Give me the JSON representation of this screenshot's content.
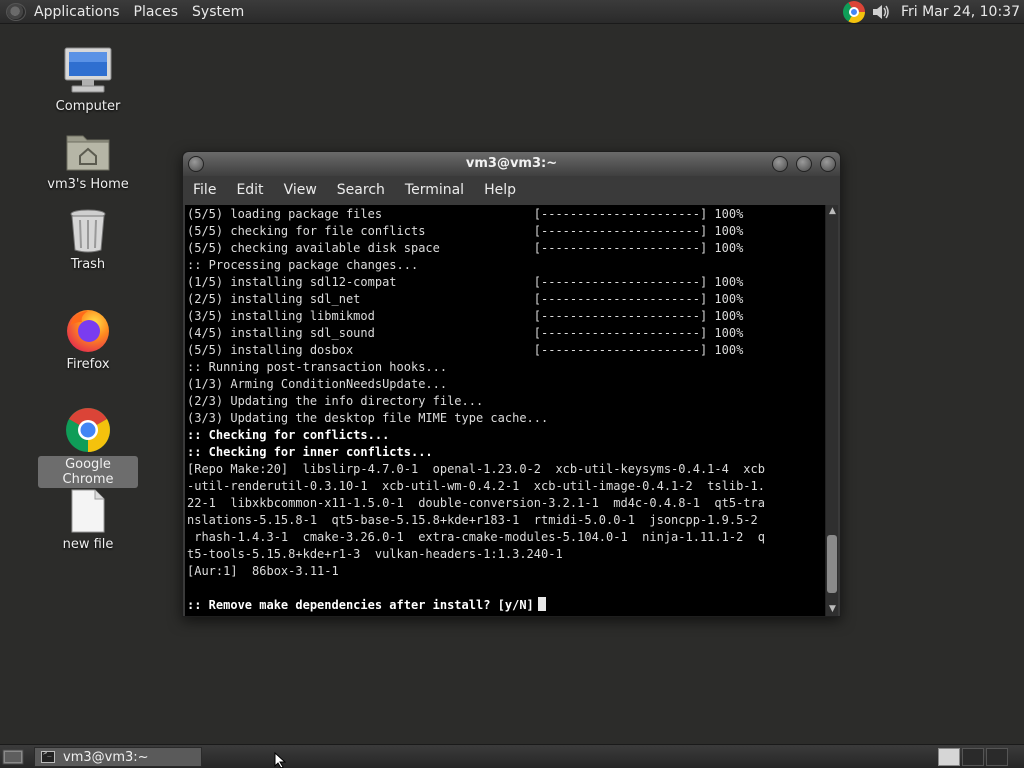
{
  "top_panel": {
    "menus": [
      "Applications",
      "Places",
      "System"
    ],
    "clock": "Fri Mar 24, 10:37"
  },
  "desktop_icons": [
    {
      "label": "Computer",
      "icon": "computer-icon"
    },
    {
      "label": "vm3's Home",
      "icon": "home-folder-icon"
    },
    {
      "label": "Trash",
      "icon": "trash-icon"
    },
    {
      "label": "Firefox",
      "icon": "firefox-icon"
    },
    {
      "label": "Google Chrome",
      "icon": "chrome-icon",
      "selected": true
    },
    {
      "label": "new file",
      "icon": "file-icon"
    }
  ],
  "window": {
    "title": "vm3@vm3:~",
    "menu": [
      "File",
      "Edit",
      "View",
      "Search",
      "Terminal",
      "Help"
    ]
  },
  "terminal": {
    "lines": [
      {
        "text": "(5/5) loading package files                     [----------------------] 100%"
      },
      {
        "text": "(5/5) checking for file conflicts               [----------------------] 100%"
      },
      {
        "text": "(5/5) checking available disk space             [----------------------] 100%"
      },
      {
        "text": ":: Processing package changes..."
      },
      {
        "text": "(1/5) installing sdl12-compat                   [----------------------] 100%"
      },
      {
        "text": "(2/5) installing sdl_net                        [----------------------] 100%"
      },
      {
        "text": "(3/5) installing libmikmod                      [----------------------] 100%"
      },
      {
        "text": "(4/5) installing sdl_sound                      [----------------------] 100%"
      },
      {
        "text": "(5/5) installing dosbox                         [----------------------] 100%"
      },
      {
        "text": ":: Running post-transaction hooks..."
      },
      {
        "text": "(1/3) Arming ConditionNeedsUpdate..."
      },
      {
        "text": "(2/3) Updating the info directory file..."
      },
      {
        "text": "(3/3) Updating the desktop file MIME type cache..."
      },
      {
        "text": ":: Checking for conflicts...",
        "bold": true
      },
      {
        "text": ":: Checking for inner conflicts...",
        "bold": true
      },
      {
        "text": "[Repo Make:20]  libslirp-4.7.0-1  openal-1.23.0-2  xcb-util-keysyms-0.4.1-4  xcb"
      },
      {
        "text": "-util-renderutil-0.3.10-1  xcb-util-wm-0.4.2-1  xcb-util-image-0.4.1-2  tslib-1."
      },
      {
        "text": "22-1  libxkbcommon-x11-1.5.0-1  double-conversion-3.2.1-1  md4c-0.4.8-1  qt5-tra"
      },
      {
        "text": "nslations-5.15.8-1  qt5-base-5.15.8+kde+r183-1  rtmidi-5.0.0-1  jsoncpp-1.9.5-2"
      },
      {
        "text": " rhash-1.4.3-1  cmake-3.26.0-1  extra-cmake-modules-5.104.0-1  ninja-1.11.1-2  q"
      },
      {
        "text": "t5-tools-5.15.8+kde+r1-3  vulkan-headers-1:1.3.240-1"
      },
      {
        "text": "[Aur:1]  86box-3.11-1"
      },
      {
        "text": ""
      },
      {
        "text": ":: Remove make dependencies after install? [y/N]",
        "bold": true,
        "cursor": true
      }
    ]
  },
  "taskbar": {
    "task_label": "vm3@vm3:~"
  }
}
